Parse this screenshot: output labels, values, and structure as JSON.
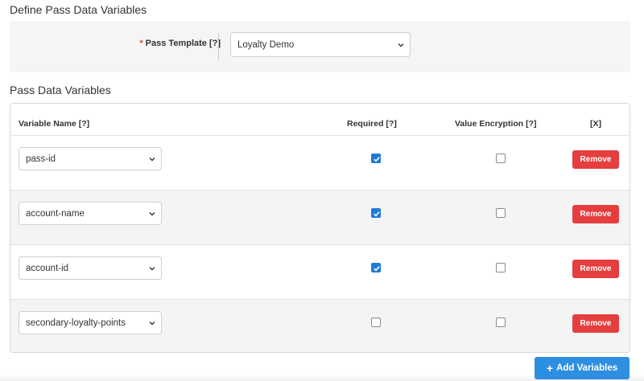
{
  "header": {
    "title": "Define Pass Data Variables"
  },
  "template": {
    "required_marker": "*",
    "label": "Pass Template [?]",
    "selected": "Loyalty Demo"
  },
  "variables_section": {
    "title": "Pass Data Variables",
    "columns": {
      "name": "Variable Name [?]",
      "required": "Required [?]",
      "encryption": "Value Encryption [?]",
      "remove": "[X]"
    },
    "rows": [
      {
        "variable": "pass-id",
        "required": true,
        "encryption": false,
        "remove_label": "Remove"
      },
      {
        "variable": "account-name",
        "required": true,
        "encryption": false,
        "remove_label": "Remove"
      },
      {
        "variable": "account-id",
        "required": true,
        "encryption": false,
        "remove_label": "Remove"
      },
      {
        "variable": "secondary-loyalty-points",
        "required": false,
        "encryption": false,
        "remove_label": "Remove"
      }
    ],
    "add_label": "Add Variables",
    "add_icon": "plus-icon"
  },
  "colors": {
    "remove": "#e53e3e",
    "primary": "#2e8fe0",
    "checked": "#1f7bd8"
  }
}
